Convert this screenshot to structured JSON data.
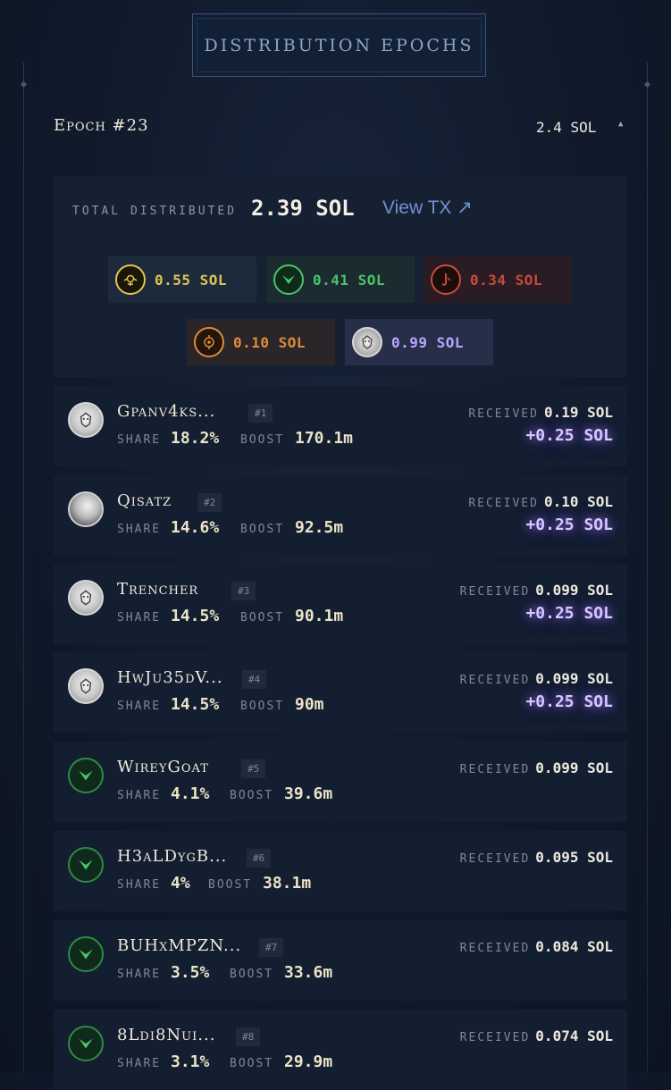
{
  "header": {
    "title": "DISTRIBUTION EPOCHS"
  },
  "epoch": {
    "title": "Epoch #23",
    "amount": "2.4 SOL",
    "collapse_icon": "chevron-up-icon"
  },
  "summary": {
    "total_label": "TOTAL DISTRIBUTED",
    "total_value": "2.39 SOL",
    "view_tx_label": "View TX ↗"
  },
  "factions": [
    {
      "value": "0.55 SOL",
      "color": "#e2c455",
      "icon": "gold-sun-faction-icon"
    },
    {
      "value": "0.41 SOL",
      "color": "#4cc36a",
      "icon": "green-chevron-faction-icon"
    },
    {
      "value": "0.34 SOL",
      "color": "#c94a3a",
      "icon": "red-hook-faction-icon"
    },
    {
      "value": "0.10 SOL",
      "color": "#e08a3a",
      "icon": "orange-target-faction-icon"
    },
    {
      "value": "0.99 SOL",
      "color": "#b9a6ff",
      "icon": "white-lion-faction-icon"
    }
  ],
  "labels": {
    "share": "SHARE",
    "boost": "BOOST",
    "received": "RECEIVED"
  },
  "rows": [
    {
      "name": "Gpanv4ks...",
      "rank": "#1",
      "share": "18.2%",
      "boost": "170.1m",
      "received": "0.19 SOL",
      "bonus": "+0.25 SOL",
      "avatar": "lion"
    },
    {
      "name": "Qisatz",
      "rank": "#2",
      "share": "14.6%",
      "boost": "92.5m",
      "received": "0.10 SOL",
      "bonus": "+0.25 SOL",
      "avatar": "photo"
    },
    {
      "name": "Trencher",
      "rank": "#3",
      "share": "14.5%",
      "boost": "90.1m",
      "received": "0.099 SOL",
      "bonus": "+0.25 SOL",
      "avatar": "lion"
    },
    {
      "name": "HwJu35dV...",
      "rank": "#4",
      "share": "14.5%",
      "boost": "90m",
      "received": "0.099 SOL",
      "bonus": "+0.25 SOL",
      "avatar": "lion"
    },
    {
      "name": "WireyGoat",
      "rank": "#5",
      "share": "4.1%",
      "boost": "39.6m",
      "received": "0.099 SOL",
      "bonus": "",
      "avatar": "green"
    },
    {
      "name": "H3aLDygB...",
      "rank": "#6",
      "share": "4%",
      "boost": "38.1m",
      "received": "0.095 SOL",
      "bonus": "",
      "avatar": "green"
    },
    {
      "name": "BUHxMPZN...",
      "rank": "#7",
      "share": "3.5%",
      "boost": "33.6m",
      "received": "0.084 SOL",
      "bonus": "",
      "avatar": "green"
    },
    {
      "name": "8Ldi8Nui...",
      "rank": "#8",
      "share": "3.1%",
      "boost": "29.9m",
      "received": "0.074 SOL",
      "bonus": "",
      "avatar": "green"
    }
  ]
}
